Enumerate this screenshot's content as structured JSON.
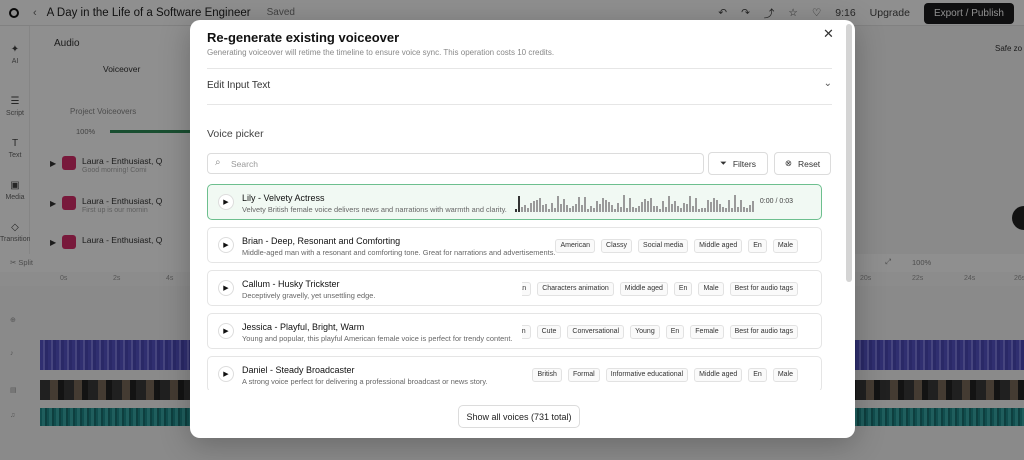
{
  "app": {
    "doc_title": "A Day in the Life of a Software Engineer",
    "saved_label": "Saved",
    "duration": "9:16",
    "upgrade_label": "Upgrade",
    "publish_label": "Export / Publish",
    "rail": [
      "AI",
      "Script",
      "Text",
      "Media",
      "Transitions"
    ],
    "panel_title": "Audio",
    "panel_tab": "Voiceover",
    "project_voiceovers_label": "Project Voiceovers",
    "project_voiceovers_pct": "100%",
    "voiceover_rows": [
      {
        "name": "Laura - Enthusiast, Q",
        "sub": "Good morning! Comi"
      },
      {
        "name": "Laura - Enthusiast, Q",
        "sub": "First up is our mornin"
      },
      {
        "name": "Laura - Enthusiast, Q",
        "sub": ""
      }
    ],
    "right_text": "Safe zo",
    "split_label": "Split",
    "zoom": "100%",
    "ruler": [
      "0s",
      "2s",
      "4s",
      "20s",
      "22s",
      "24s",
      "26s"
    ]
  },
  "modal": {
    "title": "Re-generate existing voiceover",
    "subtitle": "Generating voiceover will retime the timeline to ensure voice sync. This operation costs 10 credits.",
    "edit_input_label": "Edit Input Text",
    "voice_picker_label": "Voice picker",
    "search_placeholder": "Search",
    "filters_label": "Filters",
    "reset_label": "Reset",
    "voices": [
      {
        "name": "Lily - Velvety Actress",
        "desc": "Velvety British female voice delivers news and narrations with warmth and clarity.",
        "timer": "0:00  /  0:03",
        "selected": true,
        "tags": []
      },
      {
        "name": "Brian - Deep, Resonant and Comforting",
        "desc": "Middle-aged man with a resonant and comforting tone. Great for narrations and advertisements.",
        "tags": [
          "American",
          "Classy",
          "Social media",
          "Middle aged",
          "En",
          "Male"
        ]
      },
      {
        "name": "Callum - Husky Trickster",
        "desc": "Deceptively gravelly, yet unsettling edge.",
        "tags": [
          "nerican",
          "Characters animation",
          "Middle aged",
          "En",
          "Male",
          "Best for audio tags"
        ]
      },
      {
        "name": "Jessica - Playful, Bright, Warm",
        "desc": "Young and popular, this playful American female voice is perfect for trendy content.",
        "tags": [
          "American",
          "Cute",
          "Conversational",
          "Young",
          "En",
          "Female",
          "Best for audio tags"
        ]
      },
      {
        "name": "Daniel - Steady Broadcaster",
        "desc": "A strong voice perfect for delivering a professional broadcast or news story.",
        "tags": [
          "British",
          "Formal",
          "Informative educational",
          "Middle aged",
          "En",
          "Male"
        ]
      }
    ],
    "show_all_label": "Show all voices (731 total)"
  },
  "colors": {
    "accent_green": "#6dbf8e",
    "publish_bg": "#1c1c1e",
    "track_purple": "#5654c8",
    "track_teal": "#1f8a8a"
  }
}
